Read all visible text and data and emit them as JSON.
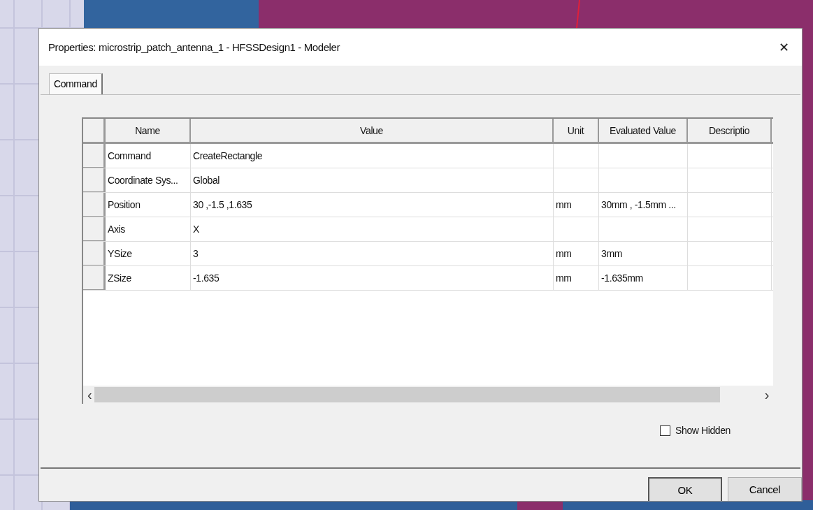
{
  "window": {
    "title": "Properties: microstrip_patch_antenna_1 - HFSSDesign1 - Modeler",
    "close": "✕"
  },
  "tabs": [
    {
      "label": "Command",
      "selected": true
    }
  ],
  "table": {
    "columns": [
      "Name",
      "Value",
      "Unit",
      "Evaluated Value",
      "Descriptio"
    ],
    "rows": [
      {
        "name": "Command",
        "value": "CreateRectangle"
      },
      {
        "name": "Coordinate Sys...",
        "value": "Global"
      },
      {
        "name": "Position",
        "value": "30 ,-1.5 ,1.635",
        "unit": "mm",
        "evaluated": "30mm , -1.5mm ..."
      },
      {
        "name": "Axis",
        "value": "X"
      },
      {
        "name": "YSize",
        "value": "3",
        "unit": "mm",
        "evaluated": "3mm"
      },
      {
        "name": "ZSize",
        "value": "-1.635",
        "unit": "mm",
        "evaluated": "-1.635mm"
      }
    ],
    "scroll_left": "‹",
    "scroll_right": "›"
  },
  "show_hidden": {
    "label": "Show Hidden",
    "checked": false
  },
  "buttons": [
    {
      "label": "OK",
      "default": true
    },
    {
      "label": "Cancel",
      "default": false
    }
  ]
}
